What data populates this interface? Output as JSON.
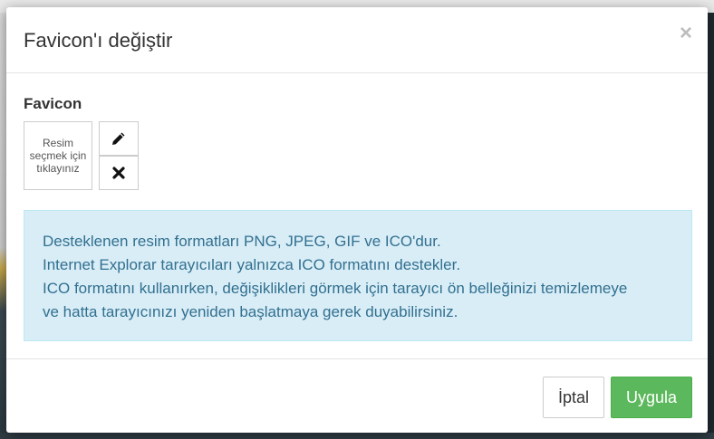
{
  "modal": {
    "title": "Favicon'ı değiştir",
    "close_symbol": "×"
  },
  "favicon": {
    "label": "Favicon",
    "placeholder": "Resim seçmek için tıklayınız",
    "edit_icon": "pencil-icon",
    "remove_icon": "times-icon"
  },
  "info": {
    "lines": [
      "Desteklenen resim formatları PNG, JPEG, GIF ve ICO'dur.",
      "Internet Explorar tarayıcıları yalnızca ICO formatını destekler.",
      "ICO formatını kullanırken, değişiklikleri görmek için tarayıcı ön belleğinizi temizlemeye",
      "ve hatta tarayıcınızı yeniden başlatmaya gerek duyabilirsiniz."
    ]
  },
  "footer": {
    "cancel_label": "İptal",
    "apply_label": "Uygula"
  },
  "colors": {
    "info_bg": "#d9edf7",
    "info_text": "#31708f",
    "apply_bg": "#5cb85c"
  }
}
